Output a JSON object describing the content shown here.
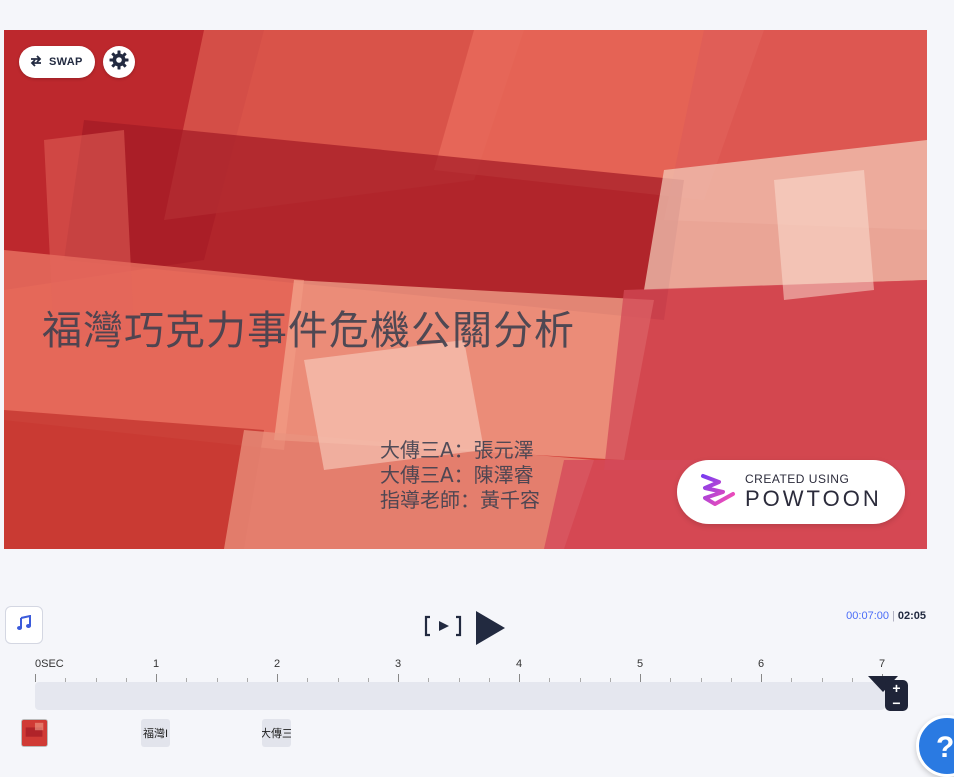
{
  "toolbar": {
    "swap_label": "SWAP",
    "settings_icon": "gear-icon",
    "swap_icon": "swap-arrows-icon"
  },
  "slide": {
    "title": "福灣巧克力事件危機公關分析",
    "authors": [
      "大傳三A：張元澤",
      "大傳三A：陳澤睿",
      "指導老師：黃千容"
    ],
    "background": "red-orange abstract watercolor plaid",
    "colors": {
      "base": "#c8322d",
      "text": "#3f4150"
    }
  },
  "badge": {
    "small": "CREATED USING",
    "big": "POWTOON"
  },
  "player": {
    "music_icon": "music-note-icon",
    "frame_icon": "play-frame-icon",
    "play_icon": "play-icon",
    "time_current": "00:07:00",
    "time_separator": "|",
    "time_total": "02:05"
  },
  "timeline": {
    "labels": [
      "0SEC",
      "1",
      "2",
      "3",
      "4",
      "5",
      "6",
      "7"
    ],
    "zoom_plus": "+",
    "zoom_minus": "−",
    "thumbnails": [
      "",
      "福灣I",
      "大傳三"
    ]
  },
  "help": {
    "label": "?"
  }
}
